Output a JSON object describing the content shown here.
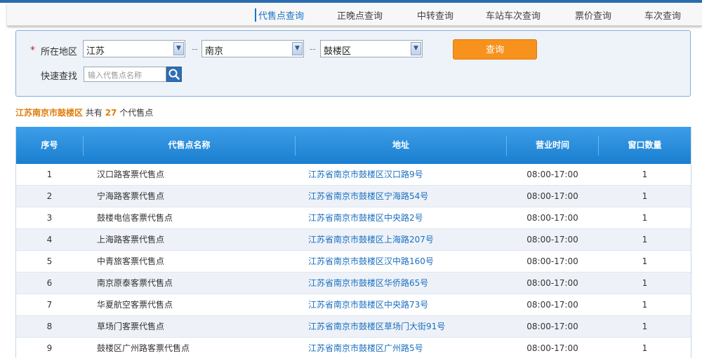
{
  "nav": {
    "items": [
      "代售点查询",
      "正晚点查询",
      "中转查询",
      "车站车次查询",
      "票价查询",
      "车次查询"
    ],
    "active_index": 0
  },
  "search": {
    "required_mark": "*",
    "region_label": "所在地区",
    "province": "江苏",
    "city": "南京",
    "district": "鼓楼区",
    "separator": "--",
    "query_button": "查询",
    "quick_label": "快速查找",
    "quick_placeholder": "输入代售点名称"
  },
  "summary": {
    "region": "江苏南京市鼓楼区",
    "prefix": "共有",
    "count": "27",
    "suffix": "个代售点"
  },
  "table": {
    "headers": [
      "序号",
      "代售点名称",
      "地址",
      "营业时间",
      "窗口数量"
    ],
    "rows": [
      {
        "no": "1",
        "name": "汉口路客票代售点",
        "address": "江苏省南京市鼓楼区汉口路9号",
        "hours": "08:00-17:00",
        "windows": "1"
      },
      {
        "no": "2",
        "name": "宁海路客票代售点",
        "address": "江苏省南京市鼓楼区宁海路54号",
        "hours": "08:00-17:00",
        "windows": "1"
      },
      {
        "no": "3",
        "name": "鼓楼电信客票代售点",
        "address": "江苏省南京市鼓楼区中央路2号",
        "hours": "08:00-17:00",
        "windows": "1"
      },
      {
        "no": "4",
        "name": "上海路客票代售点",
        "address": "江苏省南京市鼓楼区上海路207号",
        "hours": "08:00-17:00",
        "windows": "1"
      },
      {
        "no": "5",
        "name": "中青旅客票代售点",
        "address": "江苏省南京市鼓楼区汉中路160号",
        "hours": "08:00-17:00",
        "windows": "1"
      },
      {
        "no": "6",
        "name": "南京原泰客票代售点",
        "address": "江苏省南京市鼓楼区华侨路65号",
        "hours": "08:00-17:00",
        "windows": "1"
      },
      {
        "no": "7",
        "name": "华夏航空客票代售点",
        "address": "江苏省南京市鼓楼区中央路73号",
        "hours": "08:00-17:00",
        "windows": "1"
      },
      {
        "no": "8",
        "name": "草场门客票代售点",
        "address": "江苏省南京市鼓楼区草场门大街91号",
        "hours": "08:00-17:00",
        "windows": "1"
      },
      {
        "no": "9",
        "name": "鼓楼区广州路客票代售点",
        "address": "江苏省南京市鼓楼区广州路5号",
        "hours": "08:00-17:00",
        "windows": "1"
      }
    ]
  },
  "colors": {
    "accent": "#1a74c6",
    "header_blue": "#1a7fd0",
    "query_orange": "#f7921d",
    "highlight_orange": "#e07c0c"
  }
}
